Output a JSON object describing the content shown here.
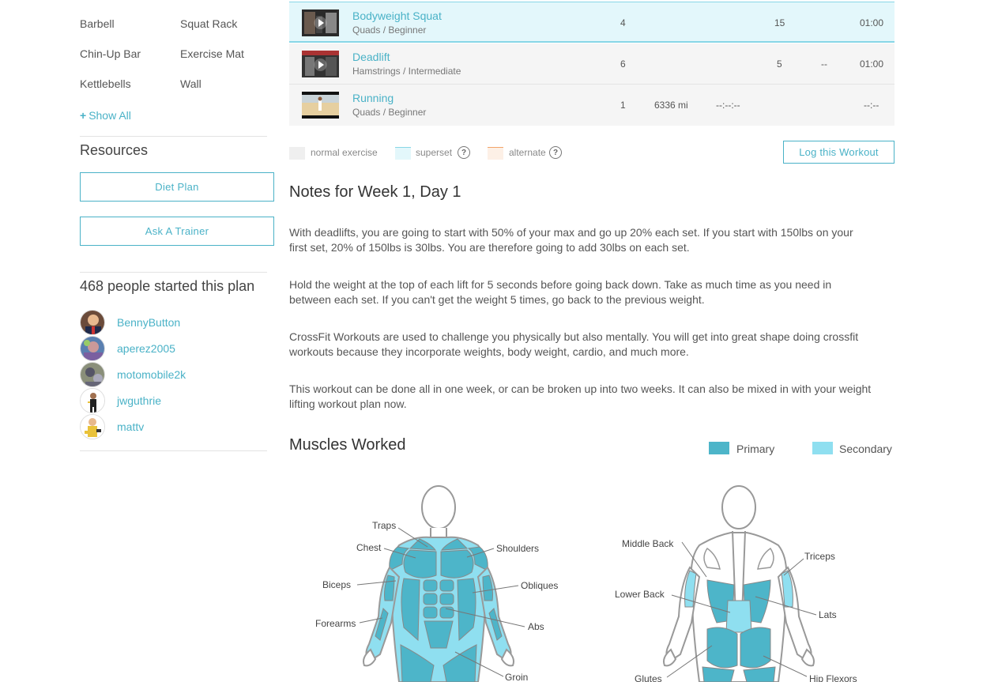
{
  "sidebar": {
    "equipment": {
      "items": [
        "Barbell",
        "Squat Rack",
        "Chin-Up Bar",
        "Exercise Mat",
        "Kettlebells",
        "Wall"
      ],
      "show_all": "Show All"
    },
    "resources": {
      "title": "Resources",
      "buttons": [
        "Diet Plan",
        "Ask A Trainer"
      ]
    },
    "people": {
      "title": "468 people started this plan",
      "users": [
        "BennyButton",
        "aperez2005",
        "motomobile2k",
        "jwguthrie",
        "mattv"
      ]
    }
  },
  "exercises": [
    {
      "name": "Bodyweight Squat",
      "sub": "Quads / Beginner",
      "sets": "4",
      "distance": "",
      "time": "",
      "reps": "15",
      "weight": "",
      "rest": "01:00",
      "type": "superset"
    },
    {
      "name": "Deadlift",
      "sub": "Hamstrings / Intermediate",
      "sets": "6",
      "distance": "",
      "time": "",
      "reps": "5",
      "weight": "--",
      "rest": "01:00",
      "type": "normal"
    },
    {
      "name": "Running",
      "sub": "Quads / Beginner",
      "sets": "1",
      "distance": "6336 mi",
      "time": "--:--:--",
      "reps": "",
      "weight": "",
      "rest": "--:--",
      "type": "normal"
    }
  ],
  "legend": {
    "normal": "normal exercise",
    "superset": "superset",
    "alternate": "alternate",
    "help": "?",
    "colors": {
      "normal": "#efefef",
      "superset": "#e3f7fb",
      "superset_border": "#88d6e6",
      "alternate": "#fdf0e6",
      "alternate_border": "#f2a46a"
    }
  },
  "log_button": "Log this Workout",
  "notes": {
    "title": "Notes for Week 1, Day 1",
    "paragraphs": [
      "With deadlifts, you are going to start with 50% of your max and go up 20% each set. If you start with 150lbs on your first set, 20% of 150lbs is 30lbs. You are therefore going to add 30lbs on each set.",
      "Hold the weight at the top of each lift for 5 seconds before going back down. Take as much time as you need in between each set. If you can't get the weight 5 times, go back to the previous weight.",
      "CrossFit Workouts are used to challenge you physically but also mentally. You will get into great shape doing crossfit workouts because they incorporate weights, body weight, cardio, and much more.",
      "This workout can be done all in one week, or can be broken up into two weeks. It can also be mixed in with your weight lifting workout plan now."
    ]
  },
  "muscles": {
    "title": "Muscles Worked",
    "primary": "Primary",
    "secondary": "Secondary",
    "primary_color": "#4db5c9",
    "secondary_color": "#8fdff0",
    "front_labels": [
      "Traps",
      "Chest",
      "Shoulders",
      "Biceps",
      "Obliques",
      "Forearms",
      "Abs",
      "Groin"
    ],
    "back_labels": [
      "Middle Back",
      "Triceps",
      "Lower Back",
      "Lats",
      "Glutes",
      "Hip Flexors"
    ]
  },
  "accent_color": "#4ab2c7"
}
